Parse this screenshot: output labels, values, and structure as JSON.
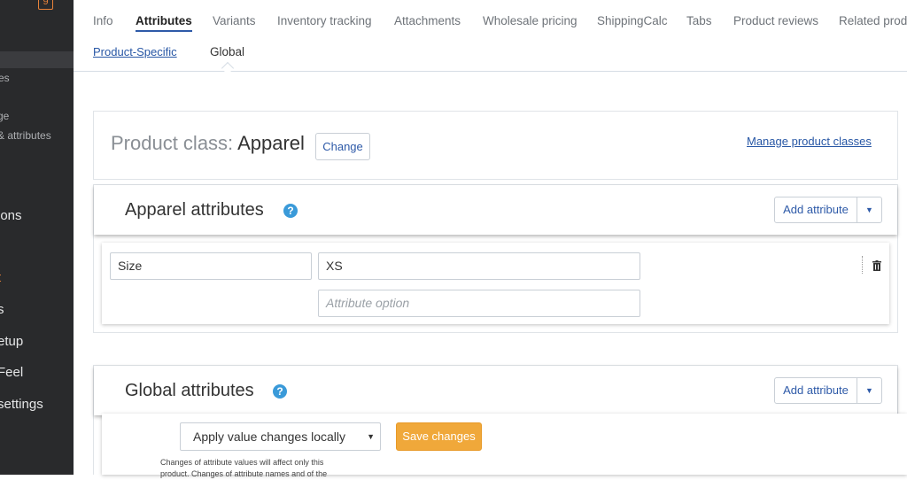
{
  "sidebar": {
    "badge": "9",
    "items": [
      {
        "label": "es"
      },
      {
        "label": "ge"
      },
      {
        "label": "& attributes"
      },
      {
        "label": "ions"
      },
      {
        "label": "t"
      },
      {
        "label": "s"
      },
      {
        "label": "etup"
      },
      {
        "label": "Feel"
      },
      {
        "label": "settings"
      }
    ]
  },
  "tabs": [
    "Info",
    "Attributes",
    "Variants",
    "Inventory tracking",
    "Attachments",
    "Wholesale pricing",
    "ShippingCalc",
    "Tabs",
    "Product reviews",
    "Related prod"
  ],
  "active_tab": "Attributes",
  "subtabs": [
    "Product-Specific",
    "Global"
  ],
  "product_class": {
    "label": "Product class:",
    "value": "Apparel",
    "change_button": "Change",
    "manage_link": "Manage product classes"
  },
  "apparel_section": {
    "title": "Apparel attributes",
    "add_button": "Add attribute"
  },
  "attribute_row": {
    "name_value": "Size",
    "option_value": "XS",
    "option_placeholder": "Attribute option"
  },
  "global_section": {
    "title": "Global attributes",
    "add_button": "Add attribute"
  },
  "footer": {
    "select_value": "Apply value changes locally",
    "save_button": "Save changes",
    "note": "Changes of attribute values will affect only this product. Changes of attribute names and of the"
  },
  "colors": {
    "accent": "#2e5aa8",
    "save_bg": "#f0a83a",
    "sidebar_bg": "#292a2c",
    "help_icon": "#3a9ad9"
  }
}
